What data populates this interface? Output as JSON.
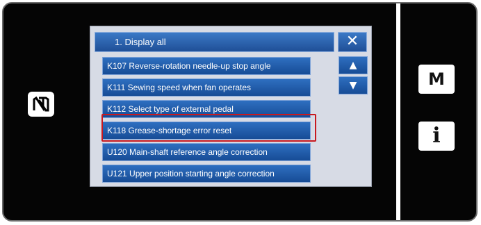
{
  "title": "1.   Display all",
  "close_label": "✕",
  "scroll": {
    "up": "▲",
    "down": "▼"
  },
  "items": [
    "K107 Reverse-rotation needle-up stop angle",
    "K111 Sewing speed when fan operates",
    "K112 Select type of external pedal",
    "K118 Grease-shortage error reset",
    "U120 Main-shaft reference angle correction",
    "U121 Upper position starting angle correction"
  ],
  "selected_index": 3,
  "side_buttons": {
    "menu": "M",
    "info": "i"
  },
  "nfc_mark": "N",
  "colors": {
    "accent_blue": "#1f4f97",
    "highlight": "#c8191f",
    "screen_bg": "#d7dbe5"
  }
}
